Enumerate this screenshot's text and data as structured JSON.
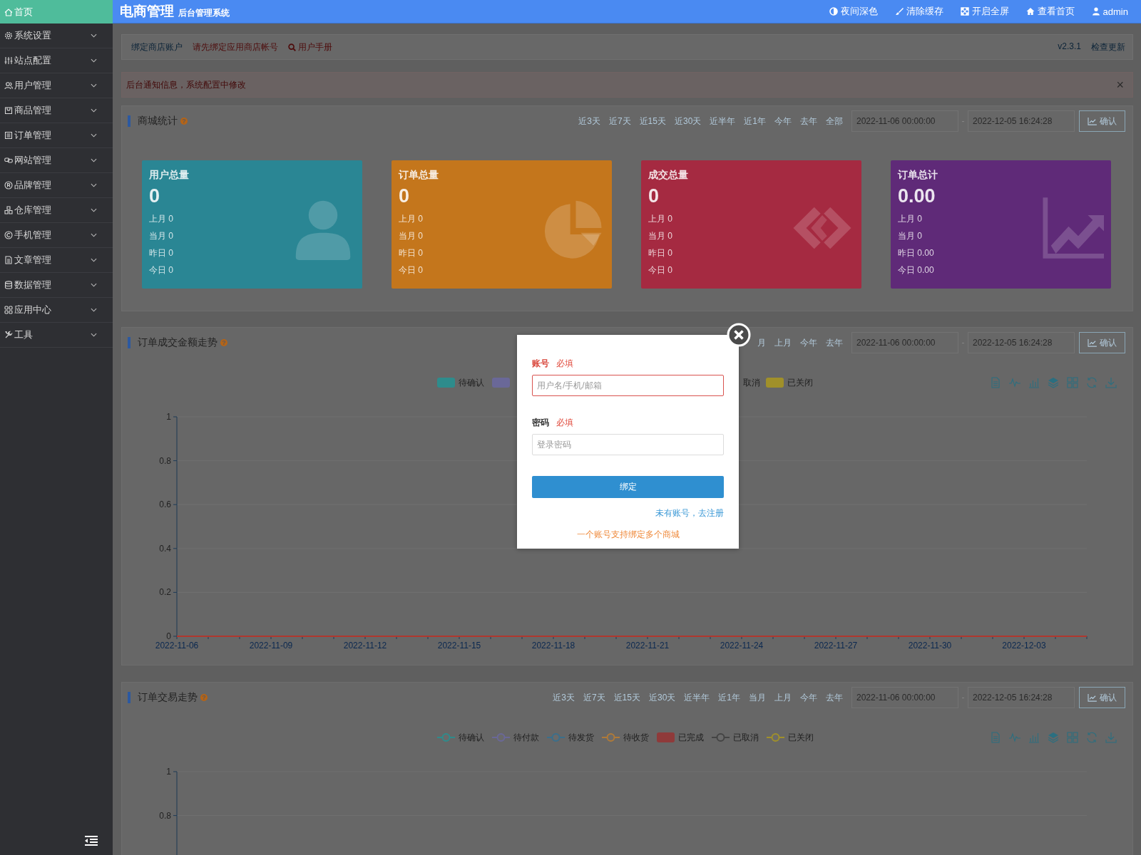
{
  "sidebar": {
    "items": [
      {
        "label": "首页",
        "kind": "link",
        "selected": true
      },
      {
        "label": "系统设置",
        "kind": "menu",
        "selected": false,
        "expanded": false
      },
      {
        "label": "站点配置",
        "kind": "menu",
        "selected": false,
        "expanded": false
      },
      {
        "label": "用户管理",
        "kind": "menu",
        "selected": false,
        "expanded": false
      },
      {
        "label": "商品管理",
        "kind": "menu",
        "selected": false,
        "expanded": false
      },
      {
        "label": "订单管理",
        "kind": "menu",
        "selected": false,
        "expanded": false
      },
      {
        "label": "网站管理",
        "kind": "menu",
        "selected": false,
        "expanded": false
      },
      {
        "label": "品牌管理",
        "kind": "menu",
        "selected": false,
        "expanded": false
      },
      {
        "label": "仓库管理",
        "kind": "menu",
        "selected": false,
        "expanded": false
      },
      {
        "label": "手机管理",
        "kind": "menu",
        "selected": false,
        "expanded": false
      },
      {
        "label": "文章管理",
        "kind": "menu",
        "selected": false,
        "expanded": false
      },
      {
        "label": "数据管理",
        "kind": "menu",
        "selected": false,
        "expanded": false
      },
      {
        "label": "应用中心",
        "kind": "menu",
        "selected": false,
        "expanded": false
      },
      {
        "label": "工具",
        "kind": "menu",
        "selected": false,
        "expanded": false
      }
    ]
  },
  "topbar": {
    "title": "电商管理",
    "subtitle": "后台管理系统",
    "actions": [
      {
        "label": "夜间深色"
      },
      {
        "label": "清除缓存"
      },
      {
        "label": "开启全屏"
      },
      {
        "label": "查看首页"
      },
      {
        "label": "admin"
      }
    ]
  },
  "toolbar": {
    "links": [
      {
        "label": "绑定商店账户",
        "kind": "plain"
      },
      {
        "label": "请先绑定应用商店帐号",
        "kind": "warning"
      },
      {
        "label": "用户手册",
        "kind": "help"
      }
    ],
    "version": "v2.3.1",
    "update": "检查更新"
  },
  "notice": {
    "text": "后台通知信息，系统配置中修改",
    "close": "×"
  },
  "stats": {
    "title": "商城统计",
    "help": "?",
    "filters": [
      "近3天",
      "近7天",
      "近15天",
      "近30天",
      "近半年",
      "近1年",
      "今年",
      "去年",
      "全部"
    ],
    "date_from": "2022-11-06 00:00:00",
    "separator": "-",
    "date_to": "2022-12-05 16:24:28",
    "confirm": "确认",
    "cards": [
      {
        "title": "用户总量",
        "value": "0",
        "lines": [
          "上月 0",
          "当月 0",
          "昨日 0",
          "今日 0"
        ],
        "color": "#2a8694"
      },
      {
        "title": "订单总量",
        "value": "0",
        "lines": [
          "上月 0",
          "当月 0",
          "昨日 0",
          "今日 0"
        ],
        "color": "#c4761c"
      },
      {
        "title": "成交总量",
        "value": "0",
        "lines": [
          "上月 0",
          "当月 0",
          "昨日 0",
          "今日 0"
        ],
        "color": "#a52a41"
      },
      {
        "title": "订单总计",
        "value": "0.00",
        "lines": [
          "上月 0",
          "当月 0",
          "昨日 0.00",
          "今日 0.00"
        ],
        "color": "#5f2a78"
      }
    ]
  },
  "charts": [
    {
      "title": "订单成交金额走势",
      "help": "?",
      "filters": [
        "月",
        "上月",
        "今年",
        "去年"
      ],
      "date_from": "2022-11-06 00:00:00",
      "separator": "-",
      "date_to": "2022-12-05 16:24:28",
      "confirm": "确认",
      "legend": [
        {
          "label": "待确认",
          "kind": "area",
          "color": "#2e8c8c"
        },
        {
          "kind": "area",
          "color": "#6a6898"
        },
        {
          "label": "取消"
        },
        {
          "label": "已关闭",
          "kind": "area",
          "color": "#a0902a"
        }
      ],
      "chart_data": {
        "type": "line",
        "categories": [
          "2022-11-06",
          null,
          null,
          "2022-11-09",
          null,
          null,
          "2022-11-12",
          null,
          null,
          "2022-11-15",
          null,
          null,
          "2022-11-18",
          null,
          null,
          "2022-11-21",
          null,
          null,
          "2022-11-24",
          null,
          null,
          "2022-11-27",
          null,
          null,
          "2022-11-30",
          null,
          null,
          "2022-12-03",
          null,
          null
        ],
        "yticks": [
          0,
          0.2,
          0.4,
          0.6,
          0.8,
          1
        ],
        "ylim": [
          0,
          1
        ],
        "grid": true,
        "series": [
          {
            "color": "#b0372e",
            "values": [
              0,
              0,
              0,
              0,
              0,
              0,
              0,
              0,
              0,
              0,
              0,
              0,
              0,
              0,
              0,
              0,
              0,
              0,
              0,
              0,
              0,
              0,
              0,
              0,
              0,
              0,
              0,
              0,
              0,
              0
            ]
          }
        ]
      }
    },
    {
      "title": "订单交易走势",
      "help": "?",
      "filters": [
        "近3天",
        "近7天",
        "近15天",
        "近30天",
        "近半年",
        "近1年",
        "当月",
        "上月",
        "今年",
        "去年"
      ],
      "date_from": "2022-11-06 00:00:00",
      "separator": "-",
      "date_to": "2022-12-05 16:24:28",
      "confirm": "确认",
      "legend": [
        {
          "label": "待确认",
          "kind": "line",
          "color": "#2e8c8c"
        },
        {
          "label": "待付款",
          "kind": "line",
          "color": "#6a6898"
        },
        {
          "label": "待发货",
          "kind": "line",
          "color": "#3a6f8c"
        },
        {
          "label": "待收货",
          "kind": "line",
          "color": "#b07a38"
        },
        {
          "label": "已完成",
          "kind": "bar",
          "color": "#8f3a3a"
        },
        {
          "label": "已取消",
          "kind": "line",
          "color": "#444444"
        },
        {
          "label": "已关闭",
          "kind": "line",
          "color": "#a0902a"
        }
      ],
      "y_axis_labels": [
        "1",
        "0.8"
      ]
    }
  ],
  "dialog": {
    "fields": [
      {
        "label": "账号",
        "required": "必填",
        "placeholder": "用户名/手机/邮箱",
        "error": true
      },
      {
        "label": "密码",
        "required": "必填",
        "placeholder": "登录密码",
        "error": false
      }
    ],
    "submit": "绑定",
    "register_link": "未有账号，去注册",
    "note": "一个账号支持绑定多个商城"
  }
}
